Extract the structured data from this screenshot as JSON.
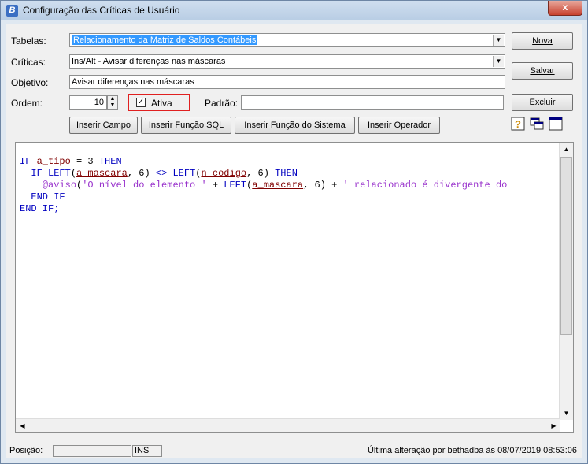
{
  "window": {
    "title": "Configuração das Críticas de Usuário",
    "app_icon_letter": "B",
    "close_glyph": "x"
  },
  "form": {
    "tabelas_label": "Tabelas:",
    "tabelas_value": "Relacionamento da Matriz de Saldos Contábeis",
    "criticas_label": "Críticas:",
    "criticas_value": "Ins/Alt - Avisar diferenças nas máscaras",
    "objetivo_label": "Objetivo:",
    "objetivo_value": "Avisar diferenças nas máscaras",
    "ordem_label": "Ordem:",
    "ordem_value": "10",
    "ativa_label": "Ativa",
    "ativa_checked_glyph": "✓",
    "padrao_label": "Padrão:",
    "padrao_value": ""
  },
  "buttons": {
    "nova": "Nova",
    "salvar": "Salvar",
    "excluir": "Excluir",
    "inserir_campo": "Inserir Campo",
    "inserir_funcao_sql": "Inserir Função SQL",
    "inserir_funcao_sistema": "Inserir Função do Sistema",
    "inserir_operador": "Inserir Operador"
  },
  "toolbar_icons": [
    "help-icon",
    "tile-windows-icon",
    "maximize-window-icon"
  ],
  "editor": {
    "lines": [
      "IF a_tipo = 3 THEN",
      "  IF LEFT(a_mascara, 6) <> LEFT(n_codigo, 6) THEN",
      "    @aviso('O nível do elemento ' + LEFT(a_mascara, 6) + ' relacionado é divergente do",
      "  END IF",
      "END IF;"
    ]
  },
  "status": {
    "posicao_label": "Posição:",
    "posicao_value": "",
    "mode": "INS",
    "last_change": "Última alteração por bethadba às 08/07/2019 08:53:06"
  },
  "colors": {
    "keyword": "#0000c0",
    "variable": "#800000",
    "string": "#9933cc",
    "highlight": "#3399ff",
    "red_box": "#e02020"
  }
}
